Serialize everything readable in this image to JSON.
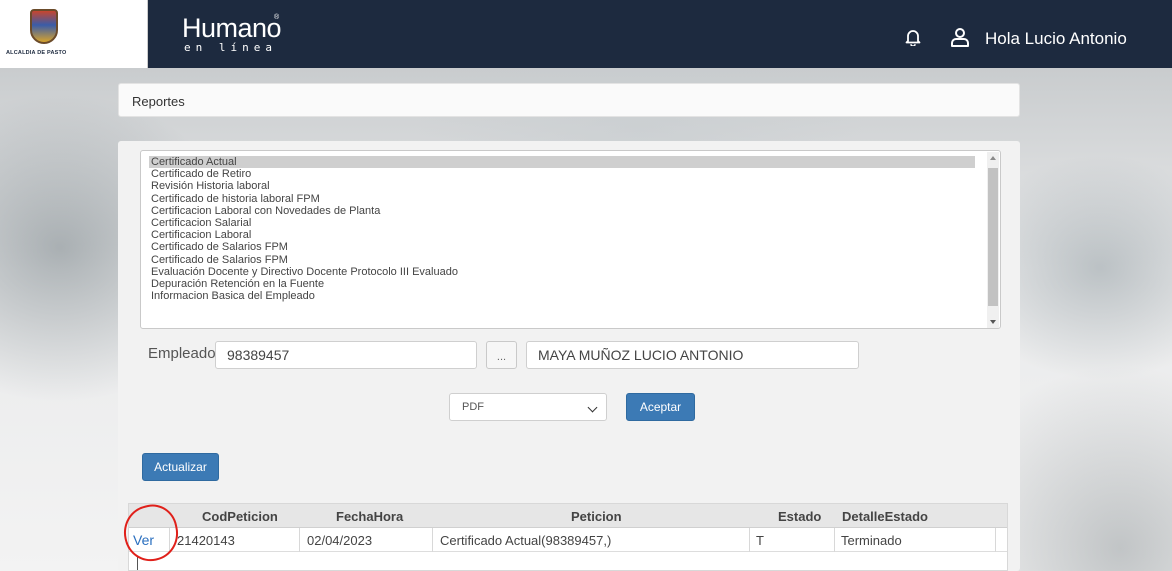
{
  "header": {
    "logo_caption": "ALCALDIA DE PASTO",
    "brand_main": "Humano",
    "brand_reg": "®",
    "brand_sub": "en línea",
    "greeting": "Hola Lucio Antonio",
    "icons": [
      "bell-icon",
      "user-icon"
    ]
  },
  "page": {
    "title": "Reportes"
  },
  "reports_list": {
    "selected_index": 0,
    "items": [
      "Certificado Actual",
      "Certificado de Retiro",
      "Revisión Historia laboral",
      "Certificado de historia laboral FPM",
      "Certificacion Laboral con Novedades de Planta",
      "Certificacion Salarial",
      "Certificacion Laboral",
      "Certificado de Salarios FPM",
      "Certificado de Salarios FPM",
      "Evaluación Docente y Directivo Docente Protocolo III Evaluado",
      "Depuración Retención en la Fuente",
      "Informacion Basica del Empleado"
    ]
  },
  "employee": {
    "label": "Empleado",
    "code": "98389457",
    "lookup_button": "...",
    "name": "MAYA MUÑOZ LUCIO ANTONIO"
  },
  "format": {
    "selected": "PDF"
  },
  "buttons": {
    "accept": "Aceptar",
    "refresh": "Actualizar"
  },
  "grid": {
    "columns": [
      "CodPeticion",
      "FechaHora",
      "Peticion",
      "Estado",
      "DetalleEstado"
    ],
    "rows": [
      {
        "link": "Ver",
        "cod": "21420143",
        "fecha": "02/04/2023",
        "peticion": "Certificado Actual(98389457,)",
        "estado": "T",
        "detalle": "Terminado"
      }
    ]
  },
  "colors": {
    "header_bg": "#1d2a3f",
    "accent_button": "#3c7ab5",
    "annotation_circle": "#e0201a",
    "link": "#2a6fbf"
  }
}
